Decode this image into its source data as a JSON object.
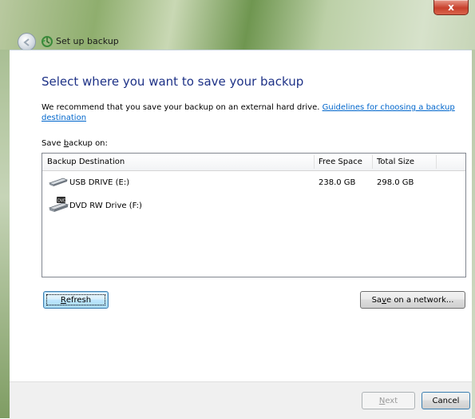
{
  "window": {
    "title": "Set up backup",
    "close_label": "x"
  },
  "page": {
    "heading": "Select where you want to save your backup",
    "recommend_text": "We recommend that you save your backup on an external hard drive.",
    "recommend_link": "Guidelines for choosing a backup destination",
    "save_label_prefix": "Save ",
    "save_label_accel": "b",
    "save_label_suffix": "ackup on:"
  },
  "list": {
    "columns": [
      "Backup Destination",
      "Free Space",
      "Total Size"
    ],
    "rows": [
      {
        "name": "USB DRIVE (E:)",
        "free": "238.0 GB",
        "total": "298.0 GB",
        "icon": "usb-drive-icon"
      },
      {
        "name": "DVD RW Drive (F:)",
        "free": "",
        "total": "",
        "icon": "dvd-drive-icon"
      }
    ]
  },
  "buttons": {
    "refresh_accel": "R",
    "refresh_rest": "efresh",
    "network_pre": "Sa",
    "network_accel": "v",
    "network_rest": "e on a network...",
    "next_accel": "N",
    "next_rest": "ext",
    "cancel": "Cancel"
  },
  "colors": {
    "heading": "#1e3287",
    "link": "#0066cc",
    "default_button_border": "#3c7fb1"
  }
}
